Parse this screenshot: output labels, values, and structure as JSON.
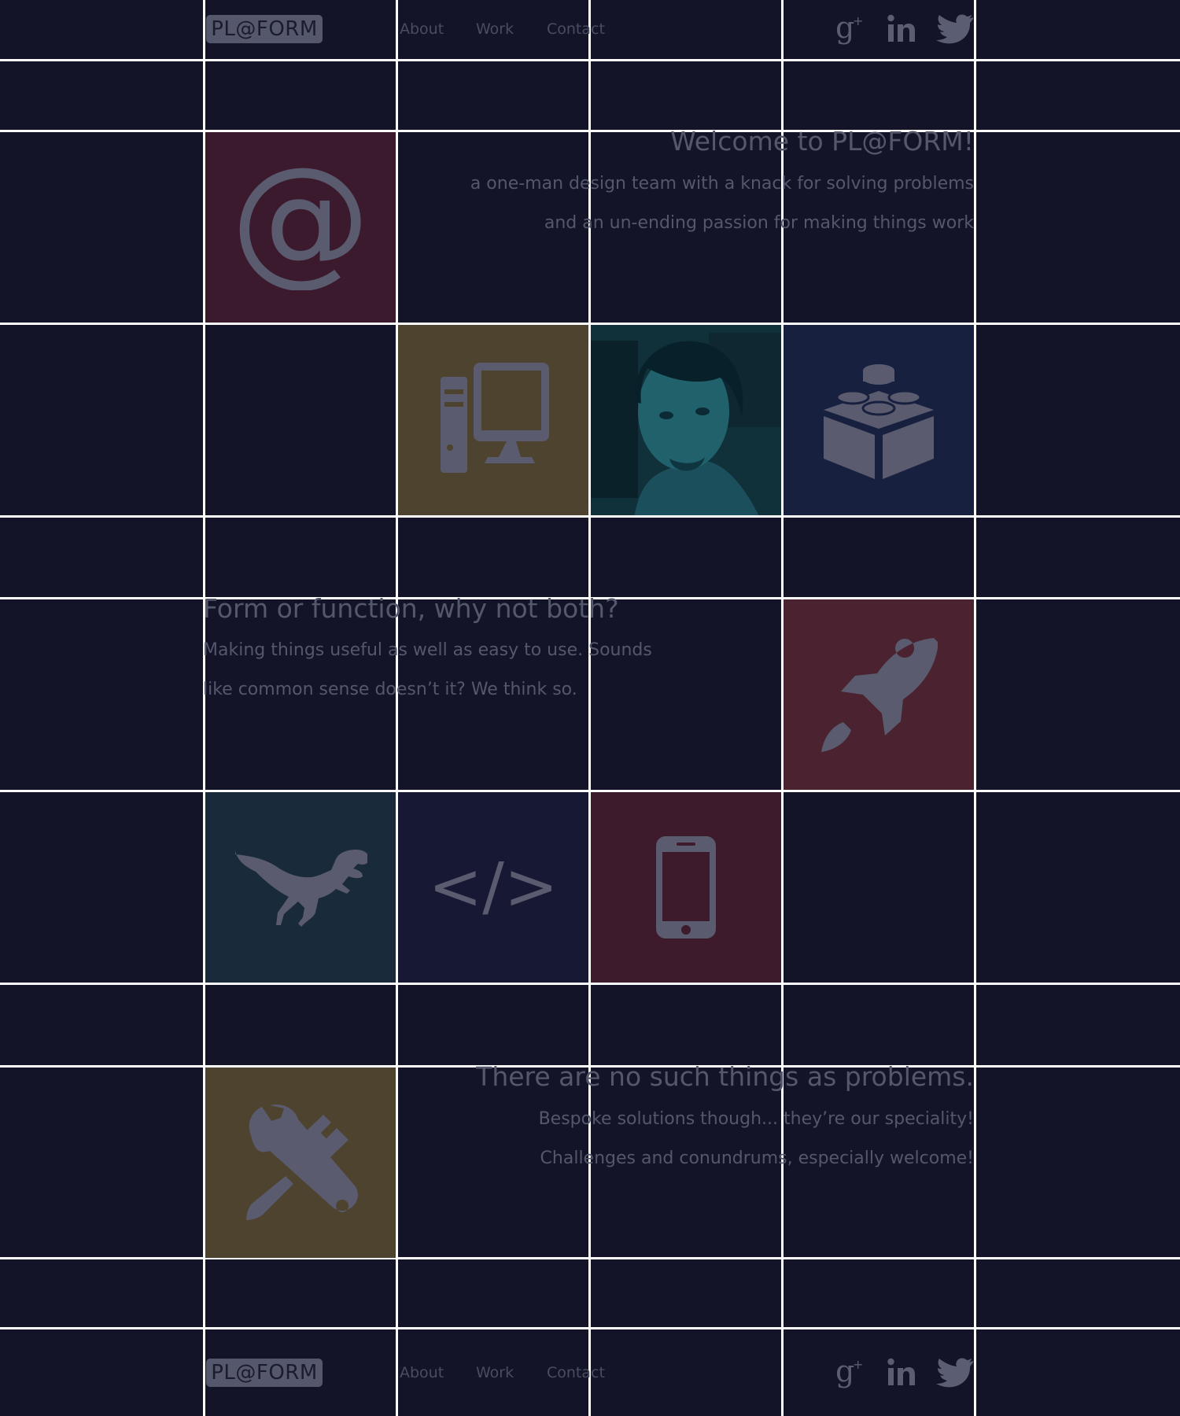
{
  "header": {
    "logo": "PL@FORM",
    "nav": [
      {
        "label": "About"
      },
      {
        "label": "Work"
      },
      {
        "label": "Contact"
      }
    ],
    "social_icons": [
      "google-plus-icon",
      "linkedin-icon",
      "twitter-icon"
    ]
  },
  "welcome": {
    "title": "Welcome to PL@FORM!",
    "line1": "a one-man design team with a knack for solving problems",
    "line2": "and an un-ending passion for making things work"
  },
  "form_function": {
    "title": "Form or function, why not both?",
    "line1": "Making things useful as well as easy to use. Sounds",
    "line2": "like common sense doesn’t it?  We think so."
  },
  "problems": {
    "title": "There are no such things as problems.",
    "line1": "Bespoke solutions though... they’re our speciality!",
    "line2": "Challenges and conundrums, especially welcome!"
  },
  "footer": {
    "logo": "PL@FORM",
    "nav": [
      {
        "label": "About"
      },
      {
        "label": "Work"
      },
      {
        "label": "Contact"
      }
    ]
  },
  "tiles": [
    {
      "icon": "at-sign-icon",
      "color": "#3c1a2d"
    },
    {
      "icon": "desktop-computer-icon",
      "color": "#4d432e"
    },
    {
      "icon": "profile-photo",
      "color": "#173f4a"
    },
    {
      "icon": "lego-brick-icon",
      "color": "#182040"
    },
    {
      "icon": "rocket-icon",
      "color": "#4b2230"
    },
    {
      "icon": "dinosaur-icon",
      "color": "#192a3b"
    },
    {
      "icon": "code-brackets-icon",
      "color": "#171833"
    },
    {
      "icon": "smartphone-icon",
      "color": "#3d1a2c"
    },
    {
      "icon": "tools-icon",
      "color": "#4d432e"
    }
  ]
}
